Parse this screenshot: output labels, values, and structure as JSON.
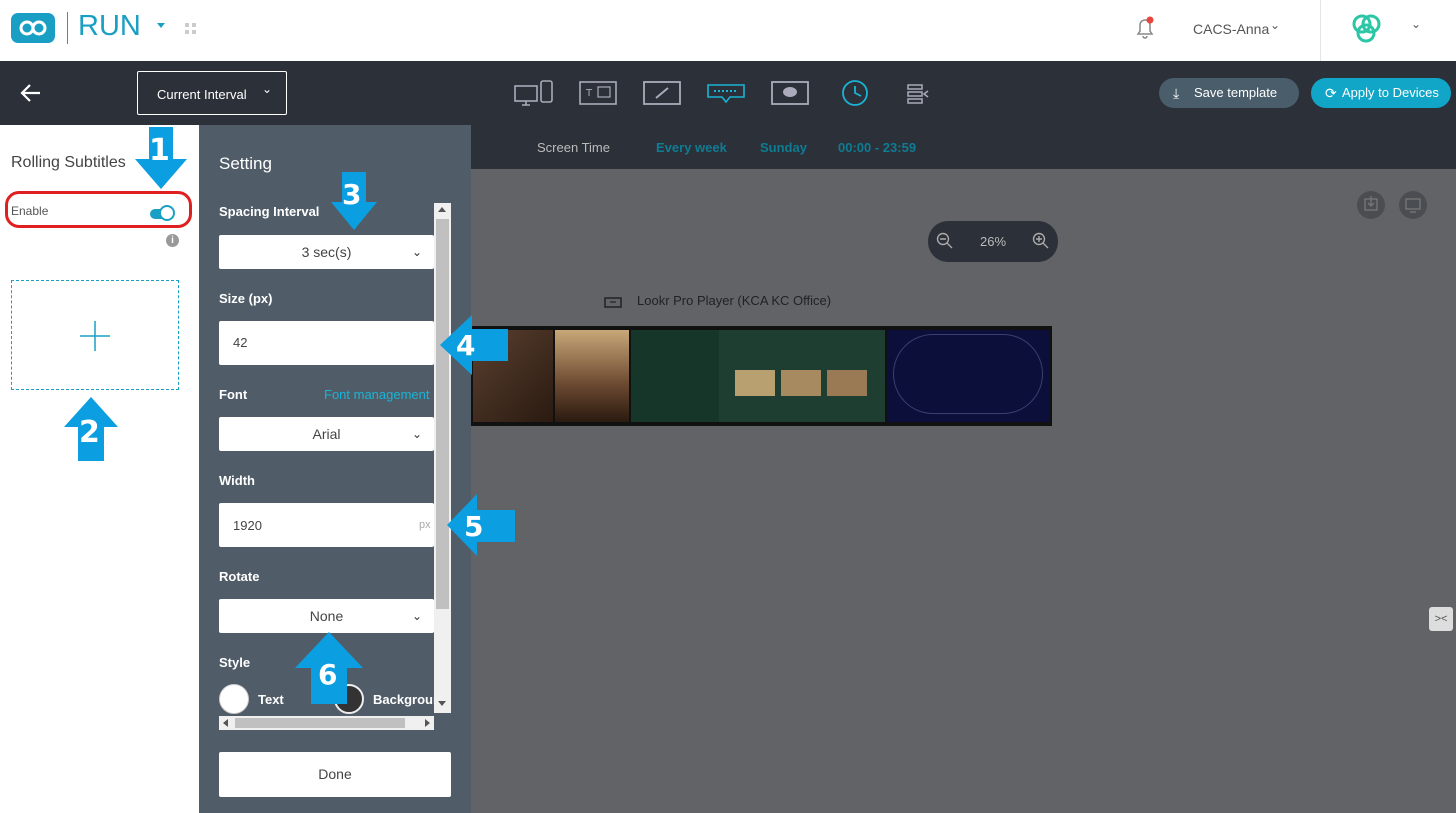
{
  "header": {
    "logo_text": "RUN",
    "user_name": "CACS-Anna"
  },
  "toolbar": {
    "interval_select": "Current Interval",
    "save_template": "Save template",
    "apply_devices": "Apply to Devices",
    "icons": [
      "display-devices-icon",
      "text-template-icon",
      "edit-screen-icon",
      "rolling-subtitle-icon",
      "message-screen-icon",
      "clock-icon",
      "layers-icon"
    ]
  },
  "left": {
    "title": "Rolling Subtitles",
    "enable_label": "Enable",
    "enabled": true
  },
  "settings": {
    "title": "Setting",
    "spacing_label": "Spacing Interval",
    "spacing_value": "3 sec(s)",
    "size_label": "Size (px)",
    "size_value": "42",
    "font_label": "Font",
    "font_management": "Font management",
    "font_value": "Arial",
    "width_label": "Width",
    "width_value": "1920",
    "width_unit": "px",
    "rotate_label": "Rotate",
    "rotate_value": "None",
    "style_label": "Style",
    "text_label": "Text",
    "background_label": "Backgroun",
    "done": "Done"
  },
  "stage": {
    "screen_time": "Screen Time",
    "every_week": "Every week",
    "day": "Sunday",
    "time_range": "00:00 - 23:59",
    "zoom": "26%",
    "player_name": "Lookr Pro Player (KCA KC Office)"
  },
  "callouts": [
    "1",
    "2",
    "3",
    "4",
    "5",
    "6"
  ],
  "colors": {
    "brand": "#1a9fc4",
    "arrow": "#0b9ee0",
    "dark": "#2c3039",
    "panel": "#505d68",
    "apply": "#11a6c7",
    "save": "#4a5d6b",
    "highlight": "#e02020"
  }
}
